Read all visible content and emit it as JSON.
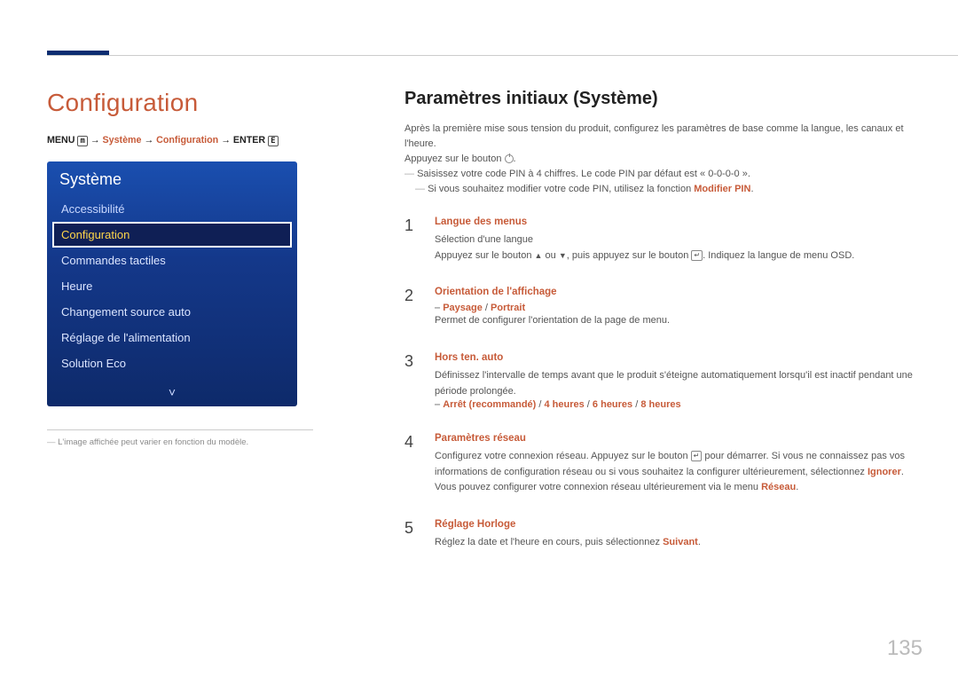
{
  "header": {
    "section_title": "Configuration"
  },
  "breadcrumb": {
    "prefix": "MENU",
    "icon1": "m",
    "arrow": "→",
    "part1": "Système",
    "part2": "Configuration",
    "suffix": "ENTER",
    "icon2": "E"
  },
  "menu": {
    "title": "Système",
    "items": [
      {
        "label": "Accessibilité",
        "selected": false
      },
      {
        "label": "Configuration",
        "selected": true
      },
      {
        "label": "Commandes tactiles",
        "selected": false
      },
      {
        "label": "Heure",
        "selected": false
      },
      {
        "label": "Changement source auto",
        "selected": false
      },
      {
        "label": "Réglage de l'alimentation",
        "selected": false
      },
      {
        "label": "Solution Eco",
        "selected": false
      }
    ],
    "more_glyph": "˅"
  },
  "footnote": "L'image affichée peut varier en fonction du modèle.",
  "main": {
    "title": "Paramètres initiaux (Système)",
    "intro_1": "Après la première mise sous tension du produit, configurez les paramètres de base comme la langue, les canaux et l'heure.",
    "intro_2_pre": "Appuyez sur le bouton ",
    "intro_2_post": ".",
    "note_1": "Saisissez votre code PIN à 4 chiffres. Le code PIN par défaut est « 0-0-0-0 ».",
    "note_2_pre": "Si vous souhaitez modifier votre code PIN, utilisez la fonction ",
    "note_2_hl": "Modifier PIN",
    "note_2_post": "."
  },
  "steps": [
    {
      "num": "1",
      "title": "Langue des menus",
      "body_1": "Sélection d'une langue",
      "body_2_pre": "Appuyez sur le bouton ",
      "body_2_mid": " ou ",
      "body_2_mid2": ", puis appuyez sur le bouton ",
      "body_2_post": ". Indiquez la langue de menu OSD."
    },
    {
      "num": "2",
      "title": "Orientation de l'affichage",
      "opt_a": "Paysage",
      "opt_sep": " / ",
      "opt_b": "Portrait",
      "body": "Permet de configurer l'orientation de la page de menu."
    },
    {
      "num": "3",
      "title": "Hors ten. auto",
      "body": "Définissez l'intervalle de temps avant que le produit s'éteigne automatiquement lorsqu'il est inactif pendant une période prolongée.",
      "opt_a": "Arrêt (recommandé)",
      "opt_b": "4 heures",
      "opt_c": "6 heures",
      "opt_d": "8 heures",
      "opt_sep": " / "
    },
    {
      "num": "4",
      "title": "Paramètres réseau",
      "body_pre": "Configurez votre connexion réseau. Appuyez sur le bouton ",
      "body_mid": " pour démarrer. Si vous ne connaissez pas vos informations de configuration réseau ou si vous souhaitez la configurer ultérieurement, sélectionnez ",
      "body_hl1": "Ignorer",
      "body_mid2": ". Vous pouvez configurer votre connexion réseau ultérieurement via le menu ",
      "body_hl2": "Réseau",
      "body_post": "."
    },
    {
      "num": "5",
      "title": "Réglage Horloge",
      "body_pre": "Réglez la date et l'heure en cours, puis sélectionnez ",
      "body_hl": "Suivant",
      "body_post": "."
    }
  ],
  "page_number": "135"
}
